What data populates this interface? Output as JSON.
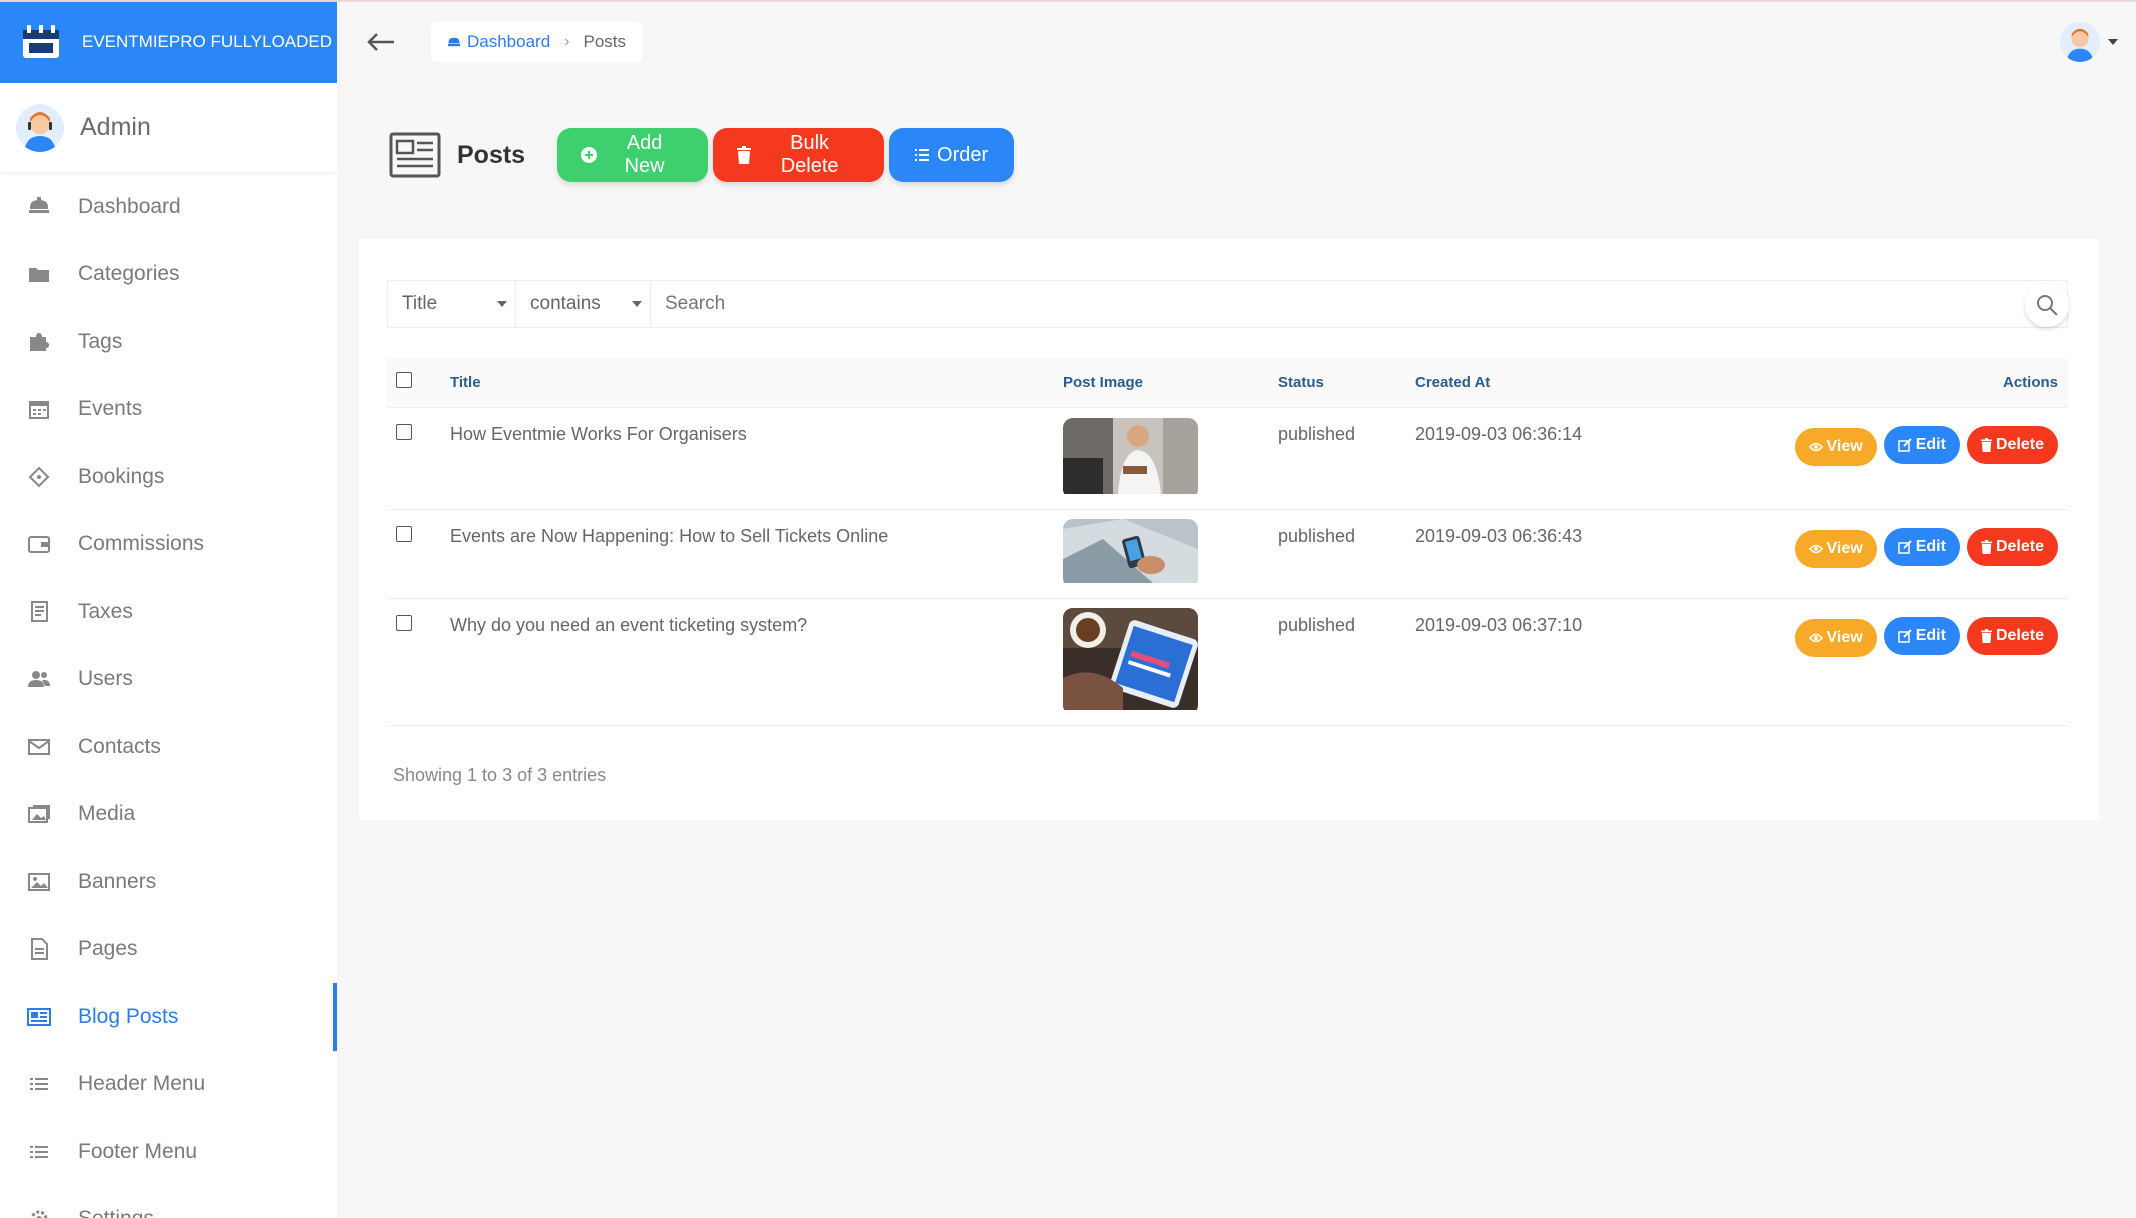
{
  "brand": {
    "name": "EVENTMIEPRO FULLYLOADED"
  },
  "sidebar": {
    "user_name": "Admin",
    "items": [
      {
        "label": "Dashboard",
        "icon": "dashboard-icon"
      },
      {
        "label": "Categories",
        "icon": "folder-icon"
      },
      {
        "label": "Tags",
        "icon": "puzzle-icon"
      },
      {
        "label": "Events",
        "icon": "calendar-icon"
      },
      {
        "label": "Bookings",
        "icon": "ticket-icon"
      },
      {
        "label": "Commissions",
        "icon": "wallet-icon"
      },
      {
        "label": "Taxes",
        "icon": "receipt-icon"
      },
      {
        "label": "Users",
        "icon": "users-icon"
      },
      {
        "label": "Contacts",
        "icon": "envelope-icon"
      },
      {
        "label": "Media",
        "icon": "images-icon"
      },
      {
        "label": "Banners",
        "icon": "image-icon"
      },
      {
        "label": "Pages",
        "icon": "file-icon"
      },
      {
        "label": "Blog Posts",
        "icon": "newspaper-icon",
        "active": true
      },
      {
        "label": "Header Menu",
        "icon": "list-icon"
      },
      {
        "label": "Footer Menu",
        "icon": "list-icon"
      },
      {
        "label": "Settings",
        "icon": "gear-icon"
      }
    ]
  },
  "breadcrumb": {
    "home": "Dashboard",
    "current": "Posts"
  },
  "page": {
    "title": "Posts",
    "add_new": "Add New",
    "bulk_delete": "Bulk Delete",
    "order": "Order"
  },
  "filter": {
    "field": "Title",
    "operator": "contains",
    "search_placeholder": "Search"
  },
  "table": {
    "headers": {
      "title": "Title",
      "image": "Post Image",
      "status": "Status",
      "created": "Created At",
      "actions": "Actions"
    },
    "rows": [
      {
        "title": "How Eventmie Works For Organisers",
        "image": "chef-photo",
        "status": "published",
        "created": "2019-09-03 06:36:14"
      },
      {
        "title": "Events are Now Happening: How to Sell Tickets Online",
        "image": "phone-desk-photo",
        "status": "published",
        "created": "2019-09-03 06:36:43"
      },
      {
        "title": "Why do you need an event ticketing system?",
        "image": "tablet-coffee-photo",
        "status": "published",
        "created": "2019-09-03 06:37:10"
      }
    ],
    "action_labels": {
      "view": "View",
      "edit": "Edit",
      "delete": "Delete"
    }
  },
  "footer_info": "Showing 1 to 3 of 3 entries",
  "colors": {
    "primary": "#2b86f7",
    "success": "#3ecf6e",
    "danger": "#f5391f",
    "warning": "#f7a928"
  }
}
